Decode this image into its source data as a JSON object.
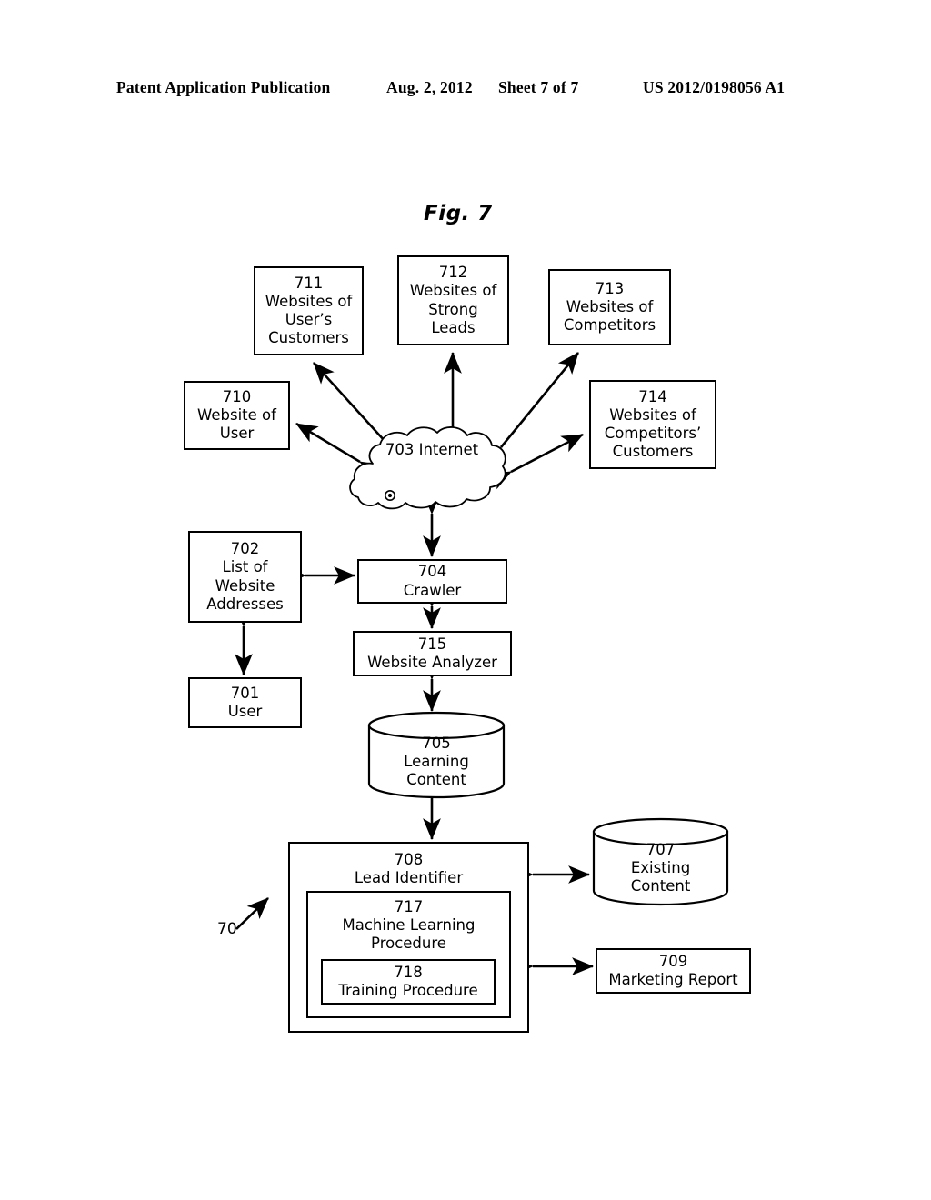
{
  "header": {
    "publication": "Patent Application Publication",
    "date": "Aug. 2, 2012",
    "sheet": "Sheet 7 of 7",
    "patent_number": "US 2012/0198056 A1"
  },
  "figure": {
    "label": "Fig. 7",
    "system_ref": "70"
  },
  "nodes": {
    "n701": {
      "ref": "701",
      "caption": "User"
    },
    "n702": {
      "ref": "702",
      "caption": "List of\nWebsite\nAddresses"
    },
    "n703": {
      "ref": "703",
      "caption": "Internet"
    },
    "n704": {
      "ref": "704",
      "caption": "Crawler"
    },
    "n705": {
      "ref": "705",
      "caption": "Learning\nContent"
    },
    "n707": {
      "ref": "707",
      "caption": "Existing\nContent"
    },
    "n708": {
      "ref": "708",
      "caption": "Lead Identifier"
    },
    "n709": {
      "ref": "709",
      "caption": "Marketing Report"
    },
    "n710": {
      "ref": "710",
      "caption": "Website of\nUser"
    },
    "n711": {
      "ref": "711",
      "caption": "Websites of\nUser’s\nCustomers"
    },
    "n712": {
      "ref": "712",
      "caption": "Websites of\nStrong\nLeads"
    },
    "n713": {
      "ref": "713",
      "caption": "Websites of\nCompetitors"
    },
    "n714": {
      "ref": "714",
      "caption": "Websites of\nCompetitors’\nCustomers"
    },
    "n715": {
      "ref": "715",
      "caption": "Website Analyzer"
    },
    "n717": {
      "ref": "717",
      "caption": "Machine Learning\nProcedure"
    },
    "n718": {
      "ref": "718",
      "caption": "Training Procedure"
    }
  },
  "colors": {
    "ink": "#000000",
    "paper": "#ffffff"
  }
}
